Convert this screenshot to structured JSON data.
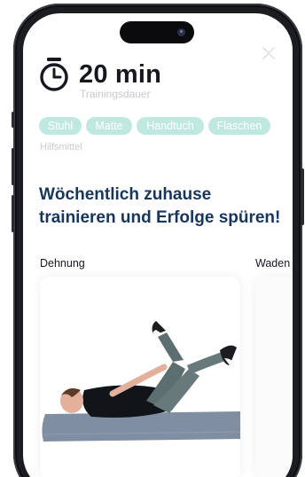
{
  "workout": {
    "duration_value": "20 min",
    "duration_label": "Trainingsdauer"
  },
  "equipment": {
    "items": [
      "Stuhl",
      "Matte",
      "Handtuch",
      "Flaschen"
    ],
    "label": "Hilfsmittel"
  },
  "headline": "Wöchentlich zuhause trainieren und Erfolge spüren!",
  "exercises": [
    {
      "title": "Dehnung"
    },
    {
      "title": "Waden"
    }
  ],
  "icons": {
    "close": "close-icon",
    "timer": "stopwatch-icon"
  },
  "colors": {
    "chip_background": "#bfe9e0",
    "headline": "#17365c",
    "primary_text": "#15181f",
    "muted_text": "#c6c8cc",
    "mat": "#7f8fa1"
  }
}
